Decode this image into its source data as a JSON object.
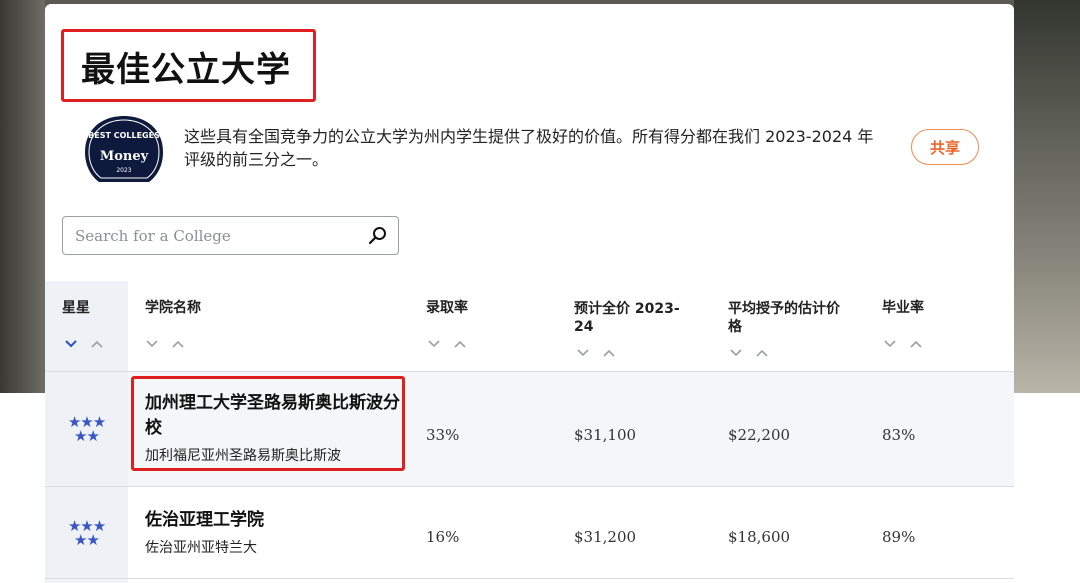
{
  "page": {
    "title": "最佳公立大学",
    "intro": "这些具有全国竞争力的公立大学为州内学生提供了极好的价值。所有得分都在我们 2023-2024 年评级的前三分之一。",
    "share_label": "共享",
    "accent_color": "#e8662a",
    "highlight_color": "#e02020"
  },
  "badge": {
    "line1": "BEST COLLEGES",
    "line2": "Money",
    "line3": "2023"
  },
  "search": {
    "placeholder": "Search for a College"
  },
  "table": {
    "headers": {
      "stars": "星星",
      "name": "学院名称",
      "admit": "录取率",
      "price": "预计全价 2023-24",
      "aid": "平均授予的估计价格",
      "grad": "毕业率"
    },
    "rows": [
      {
        "stars": "★★★ ★★",
        "name": "加州理工大学圣路易斯奥比斯波分校",
        "location": "加利福尼亚州圣路易斯奥比斯波",
        "admit": "33%",
        "price": "$31,100",
        "aid": "$22,200",
        "grad": "83%"
      },
      {
        "stars": "★★★ ★★",
        "name": "佐治亚理工学院",
        "location": "佐治亚州亚特兰大",
        "admit": "16%",
        "price": "$31,200",
        "aid": "$18,600",
        "grad": "89%"
      }
    ]
  }
}
